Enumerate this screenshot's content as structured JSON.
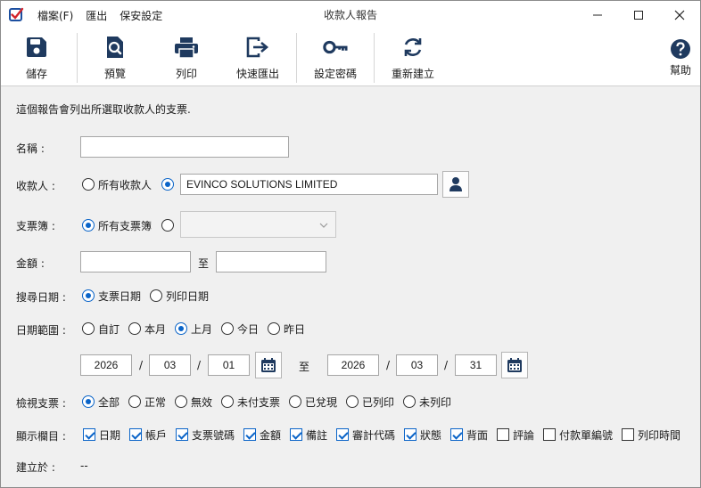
{
  "window": {
    "title": "收款人報告",
    "menu": [
      "檔案(F)",
      "匯出",
      "保安設定"
    ]
  },
  "toolbar": {
    "save": "儲存",
    "preview": "預覽",
    "print": "列印",
    "quick_export": "快速匯出",
    "set_password": "設定密碼",
    "rebuild": "重新建立",
    "help": "幫助"
  },
  "form": {
    "description": "這個報告會列出所選取收款人的支票.",
    "name": {
      "label": "名稱 :",
      "value": ""
    },
    "payee": {
      "label": "收款人 :",
      "all_label": "所有收款人",
      "selected": "specific",
      "value": "EVINCO SOLUTIONS LIMITED"
    },
    "chequebook": {
      "label": "支票簿 :",
      "all_label": "所有支票簿",
      "selected": "all",
      "value": ""
    },
    "amount": {
      "label": "金額 :",
      "from": "",
      "to_label": "至",
      "to": ""
    },
    "search_date": {
      "label": "搜尋日期 :",
      "options": [
        "支票日期",
        "列印日期"
      ],
      "selected": 0
    },
    "date_range": {
      "label": "日期範圍 :",
      "options": [
        "自訂",
        "本月",
        "上月",
        "今日",
        "昨日"
      ],
      "selected": 2,
      "from": {
        "year": "2026",
        "month": "03",
        "day": "01"
      },
      "to_label": "至",
      "to": {
        "year": "2026",
        "month": "03",
        "day": "31"
      },
      "separator": "/"
    },
    "view_cheques": {
      "label": "檢視支票 :",
      "options": [
        "全部",
        "正常",
        "無效",
        "未付支票",
        "已兌現",
        "已列印",
        "未列印"
      ],
      "selected": 0
    },
    "columns": {
      "label": "顯示欄目 :",
      "items": [
        {
          "label": "日期",
          "checked": true
        },
        {
          "label": "帳戶",
          "checked": true
        },
        {
          "label": "支票號碼",
          "checked": true
        },
        {
          "label": "金額",
          "checked": true
        },
        {
          "label": "備註",
          "checked": true
        },
        {
          "label": "審計代碼",
          "checked": true
        },
        {
          "label": "狀態",
          "checked": true
        },
        {
          "label": "背面",
          "checked": true
        },
        {
          "label": "評論",
          "checked": false
        },
        {
          "label": "付款單編號",
          "checked": false
        },
        {
          "label": "列印時間",
          "checked": false
        }
      ]
    },
    "created": {
      "label": "建立於 :",
      "value": "--"
    }
  },
  "colors": {
    "accent": "#0a64c8",
    "icon": "#1f3a5f",
    "app_icon_red": "#d3242b",
    "app_icon_blue": "#1c4fa0"
  }
}
